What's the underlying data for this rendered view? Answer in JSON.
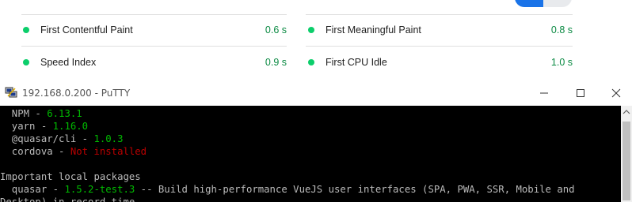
{
  "metrics": {
    "items": [
      {
        "label": "First Contentful Paint",
        "value": "0.6 s"
      },
      {
        "label": "First Meaningful Paint",
        "value": "0.8 s"
      },
      {
        "label": "Speed Index",
        "value": "0.9 s"
      },
      {
        "label": "First CPU Idle",
        "value": "1.0 s"
      }
    ],
    "status_color": "#0cce6b",
    "value_color": "#0b8a43",
    "toggle_active_color": "#1a73e8"
  },
  "putty": {
    "title": "192.168.0.200 - PuTTY",
    "icons": {
      "app": "putty-icon",
      "minimize": "minimize-icon",
      "maximize": "maximize-icon",
      "close": "close-icon"
    },
    "console": {
      "npm": {
        "label": "  NPM - ",
        "value": "6.13.1"
      },
      "yarn": {
        "label": "  yarn - ",
        "value": "1.16.0"
      },
      "quasar_cli": {
        "label": "  @quasar/cli - ",
        "value": "1.0.3"
      },
      "cordova": {
        "label": "  cordova - ",
        "value": "Not installed"
      },
      "section_heading": "Important local packages",
      "quasar": {
        "label": "  quasar - ",
        "value": "1.5.2-test.3",
        "description": " -- Build high-performance VueJS user interfaces (SPA, PWA, SSR, Mobile and"
      },
      "continuation": "Desktop) in record time"
    },
    "colors": {
      "green": "#00bb00",
      "red": "#bb0000",
      "text": "#bbbbbb",
      "background": "#000000"
    }
  }
}
